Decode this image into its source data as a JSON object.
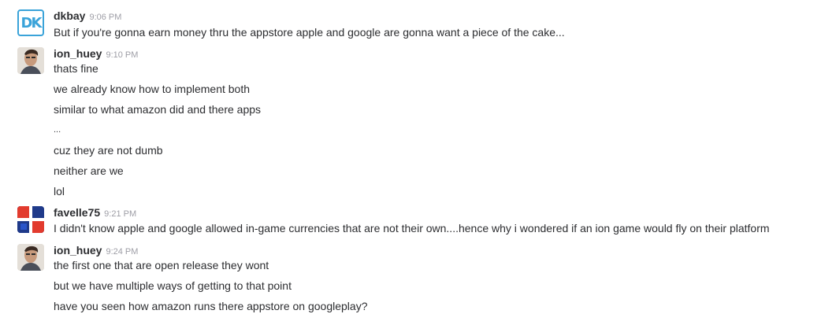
{
  "messages": [
    {
      "username": "dkbay",
      "time": "9:06 PM",
      "avatar": "dk-logo-avatar",
      "avatar_text": "DK",
      "lines": [
        "But if you're gonna earn money thru the appstore apple and google are gonna want a piece of the cake..."
      ]
    },
    {
      "username": "ion_huey",
      "time": "9:10 PM",
      "avatar": "user-photo-avatar",
      "lines": [
        "thats fine",
        "we already know how to implement both",
        "similar to what amazon did and there apps",
        "...",
        "cuz they are not dumb",
        "neither are we",
        "lol"
      ]
    },
    {
      "username": "favelle75",
      "time": "9:21 PM",
      "avatar": "red-blue-pattern-avatar",
      "lines": [
        "I didn't know apple and google allowed in-game currencies that are not their own....hence why i wondered if an ion game would fly on their platform"
      ]
    },
    {
      "username": "ion_huey",
      "time": "9:24 PM",
      "avatar": "user-photo-avatar",
      "lines": [
        "the first one that are open release they wont",
        "but we have multiple ways of getting to that point",
        "have you seen how amazon runs there appstore on googleplay?"
      ]
    }
  ]
}
